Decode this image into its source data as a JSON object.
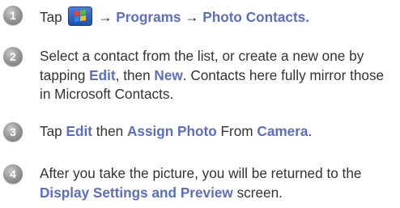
{
  "steps": [
    {
      "number": "1",
      "parts": {
        "a": "Tap ",
        "b": " → ",
        "c": "Programs",
        "d": " → ",
        "e": "Photo Contacts."
      },
      "icon": "windows-start-icon"
    },
    {
      "number": "2",
      "parts": {
        "a": "Select a contact from the list, or create a new one by tapping ",
        "b": "Edit",
        "c": ", then ",
        "d": "New",
        "e": ". Contacts here fully mirror those in Microsoft Contacts."
      }
    },
    {
      "number": "3",
      "parts": {
        "a": "Tap ",
        "b": "Edit",
        "c": " then ",
        "d": "Assign Photo",
        "e": " From ",
        "f": "Camera",
        "g": "."
      }
    },
    {
      "number": "4",
      "parts": {
        "a": "After you take the picture, you will be returned to the ",
        "b": "Display Settings and Preview",
        "c": " screen."
      }
    }
  ],
  "colors": {
    "highlight": "#5b6ec3",
    "text": "#333333",
    "badge": "#8c8c8c"
  }
}
